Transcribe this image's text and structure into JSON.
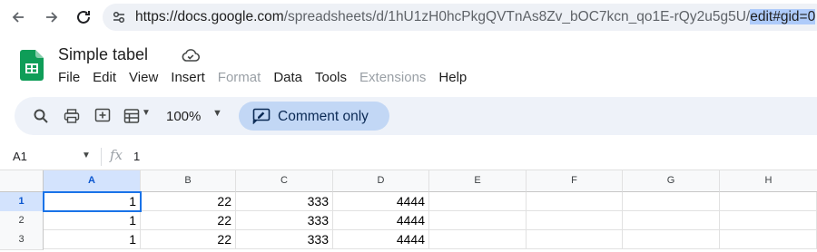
{
  "browser": {
    "url_host": "https://docs.google.com",
    "url_path": "/spreadsheets/d/1hU1zH0hcPkgQVTnAs8Zv_bOC7kcn_qo1E-rQy2u5g5U/",
    "url_selected": "edit#gid=0"
  },
  "app": {
    "title": "Simple tabel",
    "menu": [
      {
        "label": "File",
        "enabled": true
      },
      {
        "label": "Edit",
        "enabled": true
      },
      {
        "label": "View",
        "enabled": true
      },
      {
        "label": "Insert",
        "enabled": true
      },
      {
        "label": "Format",
        "enabled": false
      },
      {
        "label": "Data",
        "enabled": true
      },
      {
        "label": "Tools",
        "enabled": true
      },
      {
        "label": "Extensions",
        "enabled": false
      },
      {
        "label": "Help",
        "enabled": true
      }
    ]
  },
  "toolbar": {
    "zoom": "100%",
    "comment_label": "Comment only"
  },
  "formula_bar": {
    "cell_ref": "A1",
    "fx": "fx",
    "content": "1"
  },
  "sheet": {
    "columns": [
      "A",
      "B",
      "C",
      "D",
      "E",
      "F",
      "G",
      "H"
    ],
    "rows": [
      {
        "num": "1",
        "cells": [
          "1",
          "22",
          "333",
          "4444",
          "",
          "",
          "",
          ""
        ]
      },
      {
        "num": "2",
        "cells": [
          "1",
          "22",
          "333",
          "4444",
          "",
          "",
          "",
          ""
        ]
      },
      {
        "num": "3",
        "cells": [
          "1",
          "22",
          "333",
          "4444",
          "",
          "",
          "",
          ""
        ]
      }
    ],
    "active_column": "A",
    "active_row": "1"
  },
  "colors": {
    "accent": "#1a73e8",
    "sheets_green": "#0f9d58",
    "toolbar_bg": "#eef2f9",
    "chip_bg": "#c2d7f5"
  }
}
